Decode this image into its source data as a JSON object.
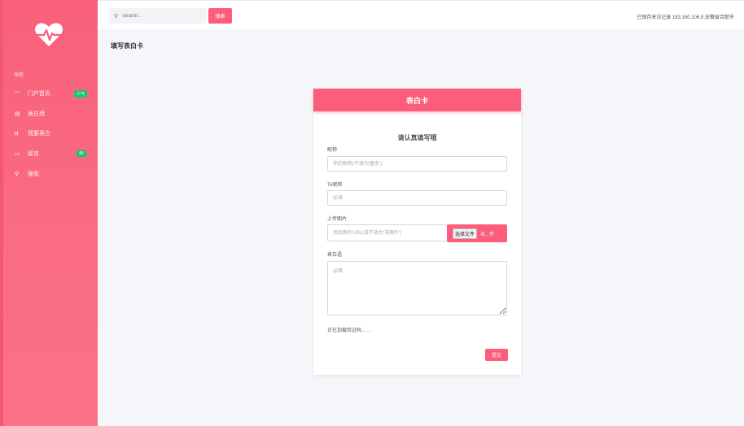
{
  "sidebar": {
    "logo_icon": "heart-pulse-icon",
    "caption": "导航",
    "items": [
      {
        "icon": "eye-icon",
        "glyph": "◠",
        "label": "门户首页",
        "badge": "人气"
      },
      {
        "icon": "list-icon",
        "glyph": "▤",
        "label": "表白墙"
      },
      {
        "icon": "plus-square-icon",
        "glyph": "◘",
        "label": "我要表白"
      },
      {
        "icon": "mail-icon",
        "glyph": "▭",
        "label": "留言",
        "badge": "48"
      },
      {
        "icon": "search-icon",
        "glyph": "⚲",
        "label": "搜索"
      }
    ]
  },
  "header": {
    "search_placeholder": "Search...",
    "search_button": "搜索",
    "visit_info": "已保存来访记录 183.160.106.5,安徽省合肥市"
  },
  "page": {
    "title": "填写表白卡"
  },
  "card": {
    "header": "表白卡",
    "heading": "请认真填写哦",
    "from_label": "昵称",
    "from_placeholder": "你的昵称(不填为'匿名')",
    "to_label": "To昵称",
    "to_placeholder": "必填",
    "upload_label": "上传图片",
    "upload_placeholder": "添加图片URL(或不填为'无图片')",
    "file_button": "选择文件",
    "file_name": "未...件",
    "message_label": "表白语",
    "message_placeholder": "必填",
    "loading_note": "正在加载验证码……",
    "submit_button": "提交"
  },
  "colors": {
    "brand": "#fb5d7b",
    "badge_green": "#17c57a"
  }
}
